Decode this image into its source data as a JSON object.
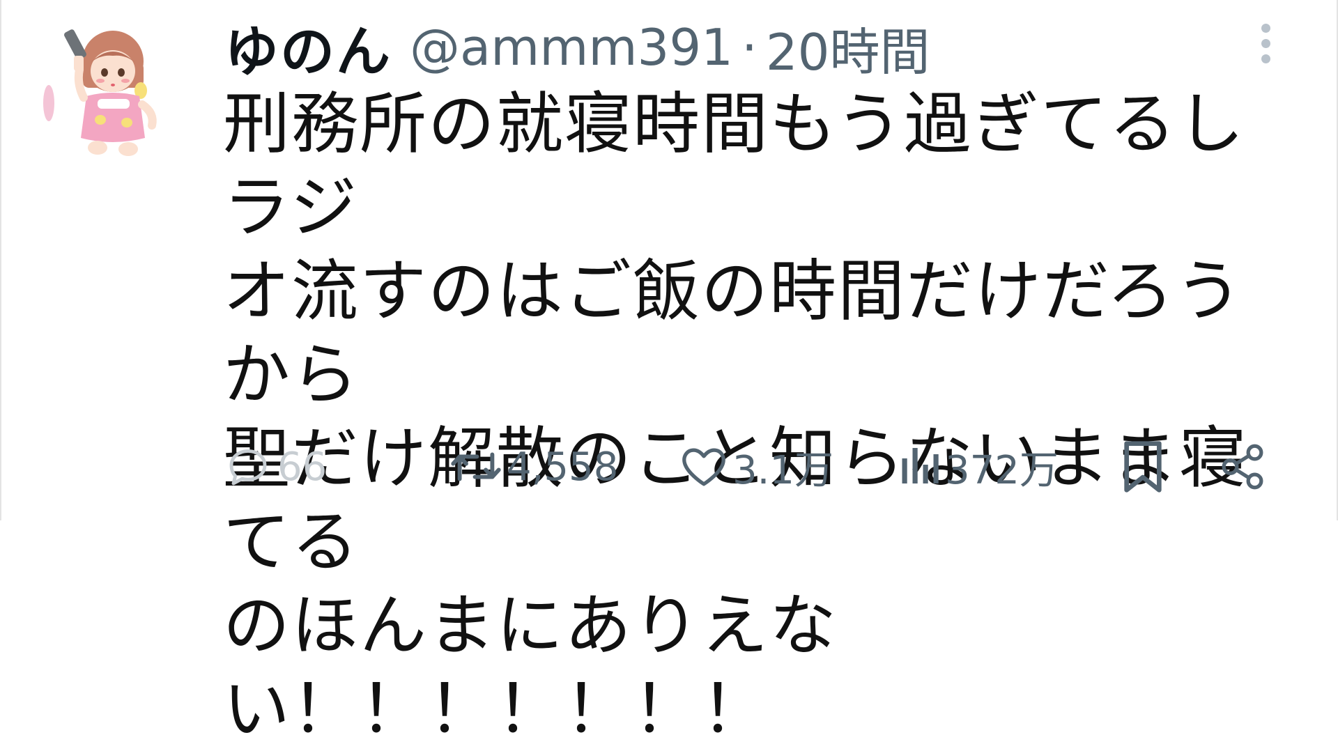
{
  "tweet": {
    "display_name": "ゆのん",
    "handle": "@ammm391",
    "separator": "·",
    "time": "20時間",
    "text": "刑務所の就寝時間もう過ぎてるしラジ\nオ流すのはご飯の時間だけだろうから\n聖だけ解散のこと知らないまま寝てる\nのほんまにありえない！！！！！！！",
    "metrics": {
      "replies": "66",
      "retweets": "4,558",
      "likes": "3.1万",
      "views": "372万"
    }
  },
  "icons": {
    "avatar": "doll-avatar",
    "more": "more-vertical-icon",
    "reply": "reply-icon",
    "retweet": "retweet-icon",
    "like": "heart-icon",
    "views": "views-icon",
    "bookmark": "bookmark-icon",
    "share": "share-icon"
  },
  "colors": {
    "text": "#0f1419",
    "secondary": "#536471",
    "faded": "#c7cdd2",
    "divider": "#e3e3e3"
  }
}
